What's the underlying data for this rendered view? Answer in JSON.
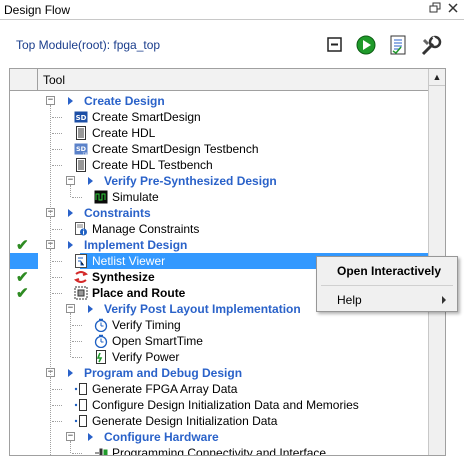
{
  "window": {
    "title": "Design Flow",
    "float_icon": "restore-icon",
    "close_icon": "close-icon"
  },
  "toolbar": {
    "top_module": "Top Module(root): fpga_top",
    "buttons": [
      {
        "name": "collapse-all-icon"
      },
      {
        "name": "run-icon"
      },
      {
        "name": "report-icon"
      },
      {
        "name": "tools-icon"
      }
    ]
  },
  "tree": {
    "column_header": "Tool",
    "rows": [
      {
        "type": "group",
        "label": "Create Design",
        "indent": 0,
        "status": ""
      },
      {
        "type": "item",
        "label": "Create SmartDesign",
        "indent": 1,
        "icon": "smartdesign-icon",
        "status": ""
      },
      {
        "type": "item",
        "label": "Create HDL",
        "indent": 1,
        "icon": "hdl-doc-icon",
        "status": ""
      },
      {
        "type": "item",
        "label": "Create SmartDesign Testbench",
        "indent": 1,
        "icon": "smartdesign-tb-icon",
        "status": ""
      },
      {
        "type": "item",
        "label": "Create HDL Testbench",
        "indent": 1,
        "icon": "hdl-doc-icon",
        "status": ""
      },
      {
        "type": "group",
        "label": "Verify Pre-Synthesized Design",
        "indent": 1,
        "status": ""
      },
      {
        "type": "item",
        "label": "Simulate",
        "indent": 2,
        "icon": "waveform-icon",
        "status": ""
      },
      {
        "type": "group",
        "label": "Constraints",
        "indent": 0,
        "status": ""
      },
      {
        "type": "item",
        "label": "Manage Constraints",
        "indent": 1,
        "icon": "constraints-icon",
        "status": ""
      },
      {
        "type": "group",
        "label": "Implement Design",
        "indent": 0,
        "status": "done"
      },
      {
        "type": "item",
        "label": "Netlist Viewer",
        "indent": 1,
        "icon": "netlist-icon",
        "status": "",
        "selected": true
      },
      {
        "type": "item",
        "label": "Synthesize",
        "indent": 1,
        "icon": "synthesize-icon",
        "status": "done",
        "bold": true
      },
      {
        "type": "item",
        "label": "Place and Route",
        "indent": 1,
        "icon": "place-route-icon",
        "status": "done",
        "bold": true
      },
      {
        "type": "group",
        "label": "Verify Post Layout Implementation",
        "indent": 1,
        "status": ""
      },
      {
        "type": "item",
        "label": "Verify Timing",
        "indent": 2,
        "icon": "timing-icon",
        "status": ""
      },
      {
        "type": "item",
        "label": "Open SmartTime",
        "indent": 2,
        "icon": "timing-icon",
        "status": ""
      },
      {
        "type": "item",
        "label": "Verify Power",
        "indent": 2,
        "icon": "power-icon",
        "status": ""
      },
      {
        "type": "group",
        "label": "Program and Debug Design",
        "indent": 0,
        "status": ""
      },
      {
        "type": "item",
        "label": "Generate FPGA Array Data",
        "indent": 1,
        "icon": "generate-doc-icon",
        "status": ""
      },
      {
        "type": "item",
        "label": "Configure Design Initialization Data and Memories",
        "indent": 1,
        "icon": "generate-doc-icon",
        "status": ""
      },
      {
        "type": "item",
        "label": "Generate Design Initialization Data",
        "indent": 1,
        "icon": "generate-doc-icon",
        "status": ""
      },
      {
        "type": "group",
        "label": "Configure Hardware",
        "indent": 1,
        "status": ""
      },
      {
        "type": "item",
        "label": "Programming Connectivity and Interface",
        "indent": 2,
        "icon": "connectivity-icon",
        "status": ""
      }
    ]
  },
  "context_menu": {
    "items": [
      {
        "label": "Open Interactively",
        "bold": true,
        "submenu": false
      },
      {
        "label": "Help",
        "bold": false,
        "submenu": true
      }
    ]
  },
  "colors": {
    "group_text": "#2a62c9",
    "check": "#2e8b22",
    "selection": "#3399ff"
  }
}
